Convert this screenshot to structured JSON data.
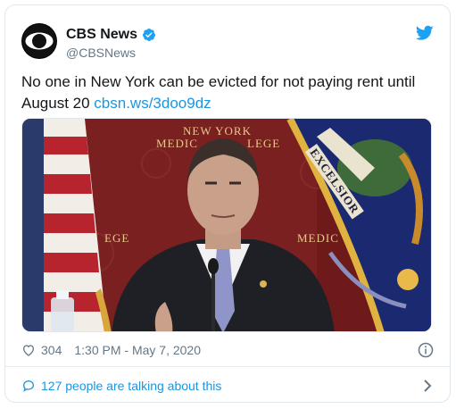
{
  "account": {
    "display_name": "CBS News",
    "handle": "@CBSNews",
    "avatar_icon": "cbs-eye-logo",
    "verified": true
  },
  "tweet": {
    "text": "No one in New York can be evicted for not paying rent until August 20",
    "link_text": "cbsn.ws/3doo9dz"
  },
  "media": {
    "backdrop_text_top": "NEW YORK",
    "backdrop_text_mid": "MEDIC",
    "backdrop_text_mid2": "LEGE",
    "backdrop_text_left": "EGE",
    "backdrop_text_right": "MEDIC",
    "flag_text": "EXCELSIOR"
  },
  "meta": {
    "likes": "304",
    "timestamp": "1:30 PM - May 7, 2020"
  },
  "footer": {
    "talking_text": "127 people are talking about this"
  },
  "colors": {
    "link": "#1b95e0",
    "muted": "#657786",
    "twitter_blue": "#1da1f2"
  }
}
